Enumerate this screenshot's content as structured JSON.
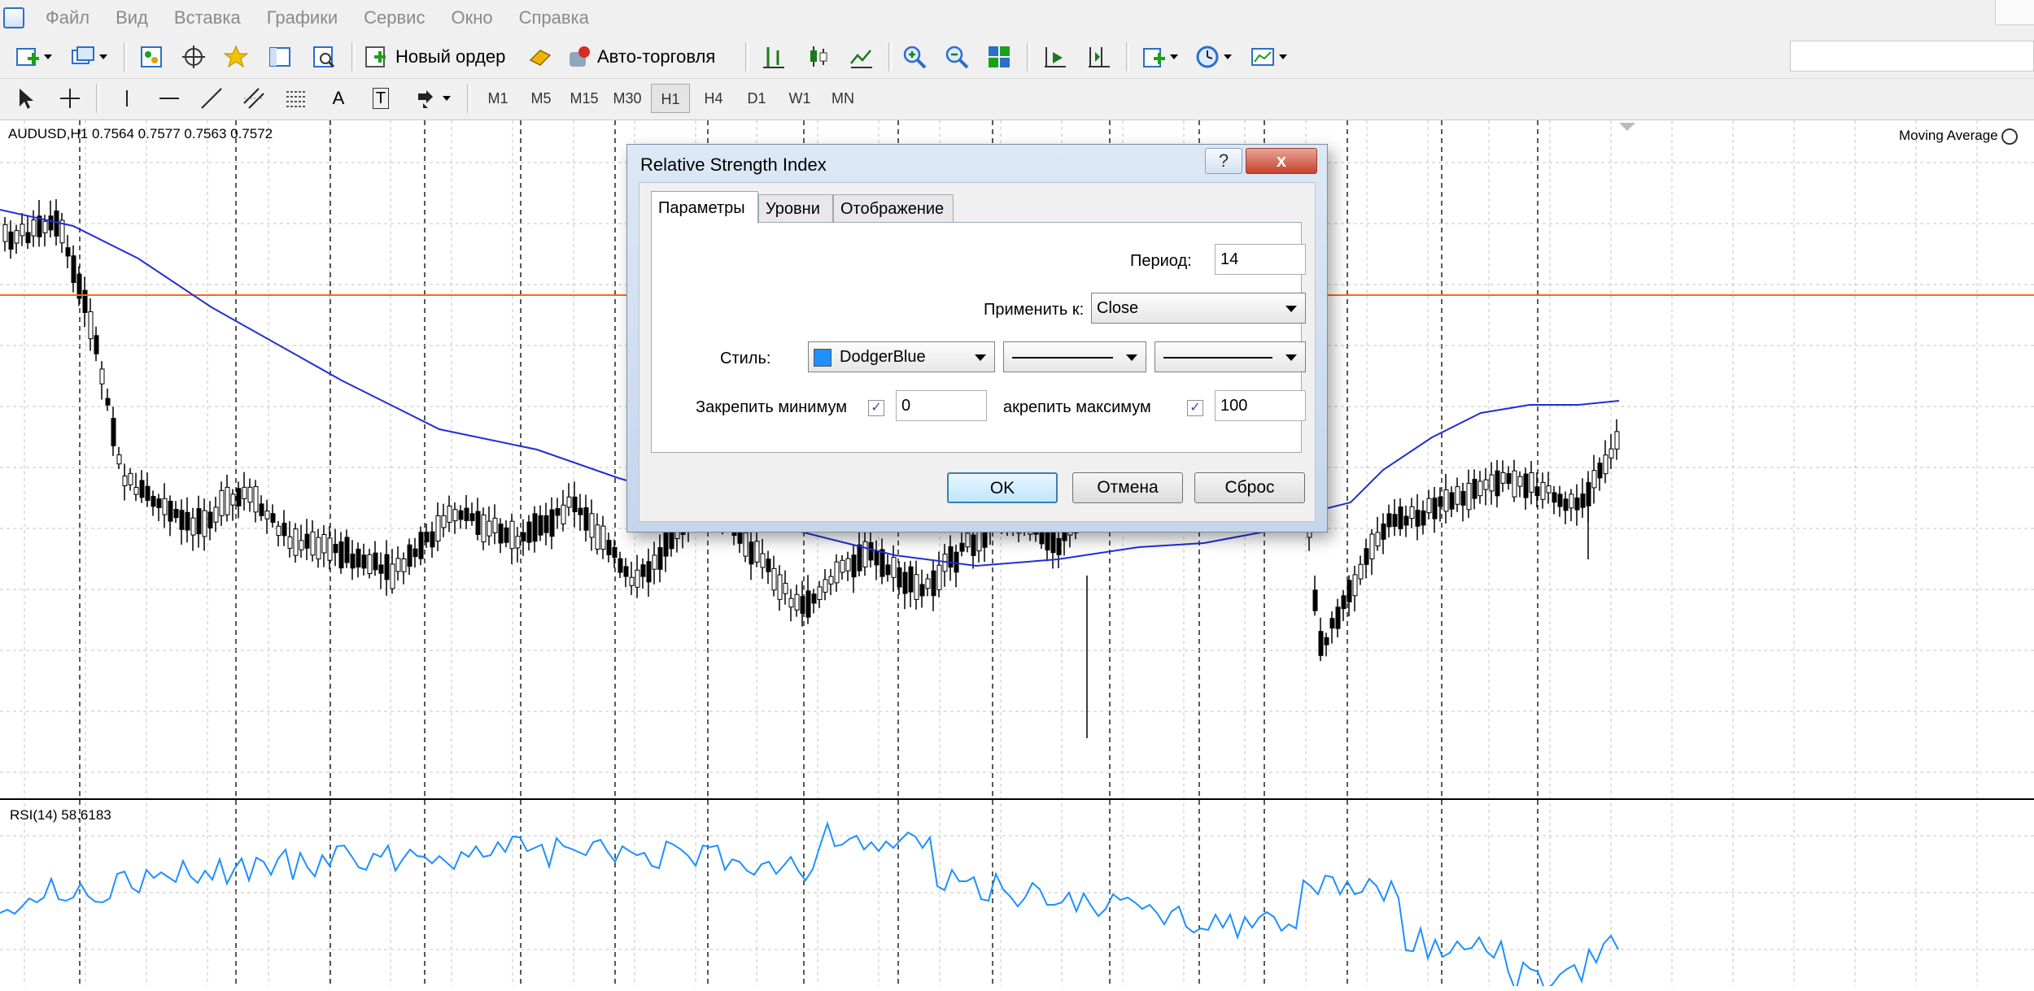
{
  "menu": {
    "items": [
      "Файл",
      "Вид",
      "Вставка",
      "Графики",
      "Сервис",
      "Окно",
      "Справка"
    ]
  },
  "toolbar": {
    "new_order_label": "Новый ордер",
    "auto_trading_label": "Авто-торговля",
    "icons": [
      "new-chart-icon",
      "profiles-icon",
      "market-watch-icon",
      "navigator-icon",
      "data-window-icon",
      "terminal-icon",
      "strategy-tester-icon",
      "new-order-icon",
      "meta-editor-icon",
      "auto-trading-icon",
      "bar-chart-icon",
      "candlestick-icon",
      "line-chart-icon",
      "zoom-in-icon",
      "zoom-out-icon",
      "tile-windows-icon",
      "auto-scroll-icon",
      "chart-shift-icon",
      "indicators-icon",
      "periods-icon",
      "templates-icon"
    ]
  },
  "drawing_tools": {
    "icons": [
      "cursor-icon",
      "crosshair-icon",
      "vertical-line-icon",
      "horizontal-line-icon",
      "trendline-icon",
      "equidistant-channel-icon",
      "fibonacci-icon",
      "text-icon",
      "text-label-icon",
      "arrows-icon"
    ],
    "text_tool": "A",
    "label_tool": "T"
  },
  "timeframes": [
    "M1",
    "M5",
    "M15",
    "M30",
    "H1",
    "H4",
    "D1",
    "W1",
    "MN"
  ],
  "active_timeframe": "H1",
  "chart": {
    "title": "AUDUSD,H1  0.7564 0.7577 0.7563 0.7572",
    "indicator_label": "Moving Average",
    "rsi_label": "RSI(14) 58.6183",
    "rsi_color": "#1e90ff",
    "ma_color": "#1f2fd6",
    "hline_color": "#f26b1f"
  },
  "dialog": {
    "title": "Relative Strength Index",
    "help_button": "?",
    "close_button": "x",
    "tabs": [
      "Параметры",
      "Уровни",
      "Отображение"
    ],
    "active_tab": "Параметры",
    "period_label": "Период:",
    "period_value": "14",
    "apply_label": "Применить к:",
    "apply_value": "Close",
    "style_label": "Стиль:",
    "style_color_name": "DodgerBlue",
    "style_color": "#1e90ff",
    "fix_min_label": "Закрепить минимум",
    "fix_min_checked": "✓",
    "fix_min_value": "0",
    "fix_max_label": "акрепить максимум",
    "fix_max_checked": "✓",
    "fix_max_value": "100",
    "ok_label": "OK",
    "cancel_label": "Отмена",
    "reset_label": "Сброс"
  }
}
